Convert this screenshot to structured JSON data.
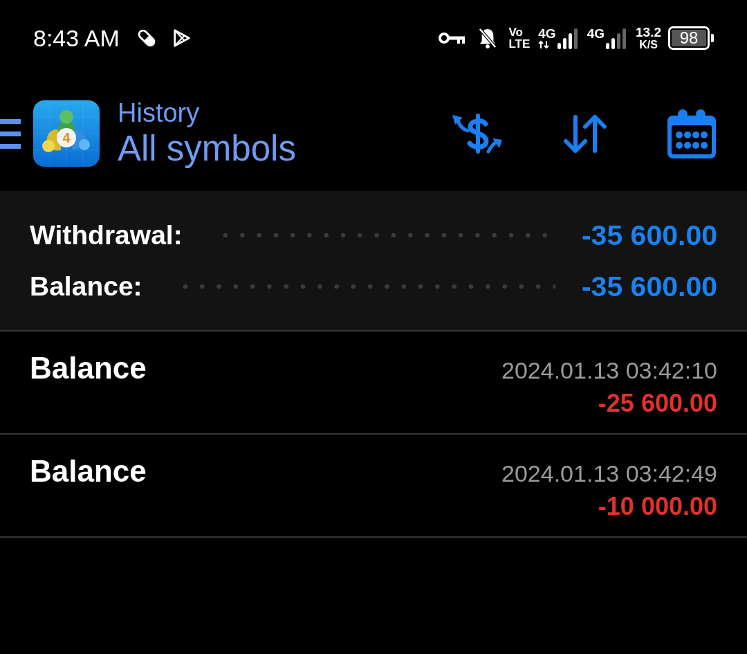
{
  "status_bar": {
    "time": "8:43 AM",
    "volte": "Vo LTE",
    "network_1": "4G",
    "network_2": "4G",
    "speed": "13.2",
    "speed_unit": "K/S",
    "battery": "98"
  },
  "toolbar": {
    "app_icon_digit": "4",
    "title": "History",
    "subtitle": "All symbols"
  },
  "summary": [
    {
      "label": "Withdrawal:",
      "value": "-35 600.00"
    },
    {
      "label": "Balance:",
      "value": "-35 600.00"
    }
  ],
  "deals": [
    {
      "type": "Balance",
      "time": "2024.01.13 03:42:10",
      "amount": "-25 600.00"
    },
    {
      "type": "Balance",
      "time": "2024.01.13 03:42:49",
      "amount": "-10 000.00"
    }
  ]
}
